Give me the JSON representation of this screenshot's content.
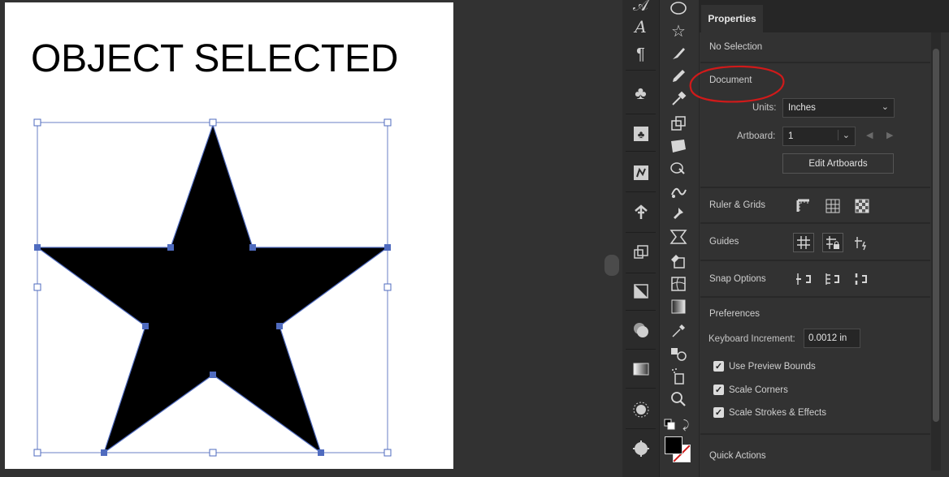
{
  "artboard": {
    "heading": "OBJECT SELECTED"
  },
  "dock": {
    "icons": [
      "type-icon",
      "paragraph-icon",
      "symbols-icon",
      "symbol-libraries-icon",
      "image-trace-icon",
      "puppet-warp-icon",
      "artboards-icon",
      "transparency-icon",
      "appearance-icon",
      "gradient-icon",
      "color-theme-icon",
      "navigator-icon"
    ]
  },
  "toolbar": {
    "tools": [
      "ellipse-tool-icon",
      "star-tool-icon",
      "paintbrush-tool-icon",
      "pencil-tool-icon",
      "eyedropper-tool-icon",
      "scale-tool-icon",
      "free-transform-icon",
      "shape-builder-icon",
      "puppet-warp-tool-icon",
      "pin-icon",
      "perspective-grid-icon",
      "live-paint-icon",
      "mesh-tool-icon",
      "gradient-tool-icon",
      "eyedropper-alt-icon",
      "blend-tool-icon",
      "symbol-sprayer-icon",
      "zoom-tool-icon"
    ],
    "fill_color": "#000000",
    "stroke_color": "#ffffff"
  },
  "panel": {
    "tab": "Properties",
    "no_selection": "No Selection",
    "document": {
      "heading": "Document",
      "units_label": "Units:",
      "units_value": "Inches",
      "artboard_label": "Artboard:",
      "artboard_value": "1",
      "edit_artboards": "Edit Artboards"
    },
    "ruler_grids": "Ruler & Grids",
    "guides": "Guides",
    "snap_options": "Snap Options",
    "preferences": {
      "heading": "Preferences",
      "keyboard_increment_label": "Keyboard Increment:",
      "keyboard_increment_value": "0.0012 in",
      "checkboxes": [
        {
          "label": "Use Preview Bounds",
          "checked": true
        },
        {
          "label": "Scale Corners",
          "checked": true
        },
        {
          "label": "Scale Strokes & Effects",
          "checked": true
        }
      ]
    },
    "quick_actions": "Quick Actions"
  },
  "colors": {
    "annotation": "#d01a1a",
    "selection": "#4f6bbf"
  }
}
